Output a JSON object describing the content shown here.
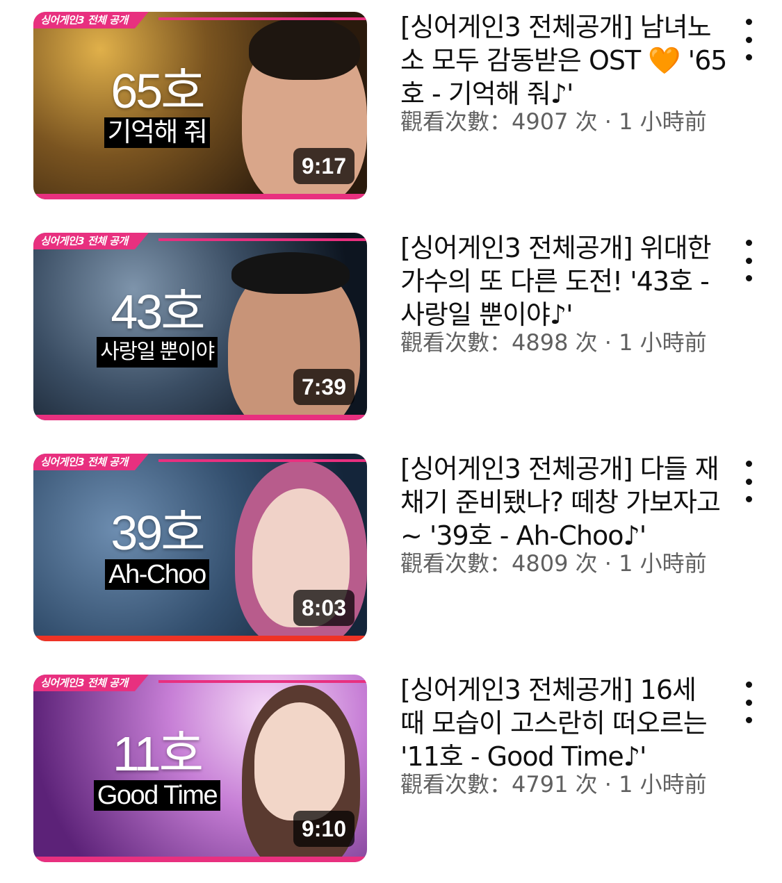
{
  "videos": [
    {
      "banner": "싱어게인3 전체 공개",
      "contestant": "65호",
      "song": "기억해 줘",
      "duration": "9:17",
      "title": "[싱어게인3 전체공개] 남녀노소 모두 감동받은 OST 🧡 '65호 - 기억해 줘♪'",
      "meta": "觀看次數：4907 次 · 1 小時前",
      "colors": {
        "bg_from": "#3a2712",
        "bg_to": "#c9932e"
      }
    },
    {
      "banner": "싱어게인3 전체 공개",
      "contestant": "43호",
      "song": "사랑일 뿐이야",
      "duration": "7:39",
      "title": "[싱어게인3 전체공개] 위대한 가수의 또 다른 도전! '43호 - 사랑일 뿐이야♪'",
      "meta": "觀看次數：4898 次 · 1 小時前",
      "colors": {
        "bg_from": "#101a27",
        "bg_to": "#5a6f86"
      }
    },
    {
      "banner": "싱어게인3 전체 공개",
      "contestant": "39호",
      "song": "Ah-Choo",
      "duration": "8:03",
      "title": "[싱어게인3 전체공개] 다들 재채기 준비됐나? 떼창 가보자고~ '39호 - Ah-Choo♪'",
      "meta": "觀看次數：4809 次 · 1 小時前",
      "colors": {
        "bg_from": "#1c3550",
        "bg_to": "#5e7fa1"
      }
    },
    {
      "banner": "싱어게인3 전체 공개",
      "contestant": "11호",
      "song": "Good Time",
      "duration": "9:10",
      "title": "[싱어게인3 전체공개] 16세 때 모습이 고스란히 떠오르는 '11호 - Good Time♪'",
      "meta": "觀看次數：4791 次 · 1 小時前",
      "colors": {
        "bg_from": "#6f2a8a",
        "bg_to": "#e8b4f0"
      }
    }
  ]
}
